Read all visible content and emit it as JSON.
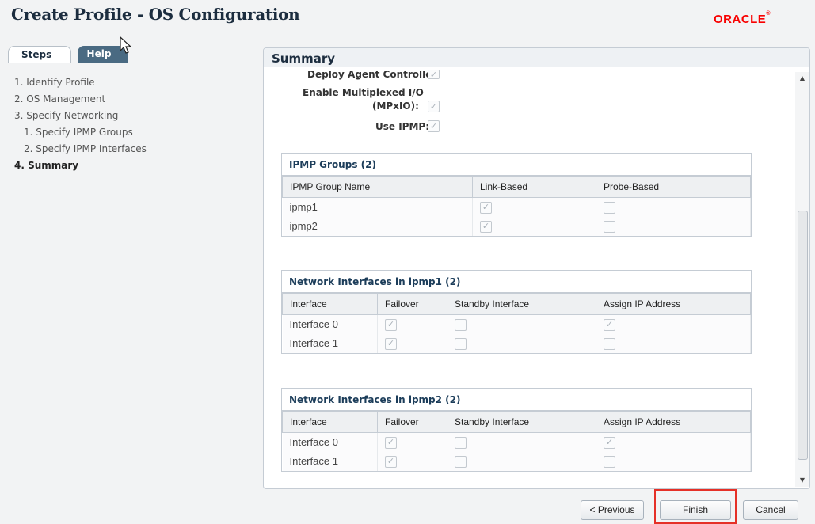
{
  "window": {
    "title": "Create Profile - OS Configuration",
    "brand": "ORACLE"
  },
  "tabs": {
    "steps": "Steps",
    "help": "Help"
  },
  "steps": [
    {
      "label": "1.  Identify Profile"
    },
    {
      "label": "2.  OS Management"
    },
    {
      "label": "3.  Specify Networking"
    },
    {
      "label": "1.  Specify IPMP Groups"
    },
    {
      "label": "2.  Specify IPMP Interfaces"
    },
    {
      "label": "4.  Summary"
    }
  ],
  "summary": {
    "title": "Summary",
    "fields": {
      "deploy_agent": {
        "label": "Deploy Agent Controller:",
        "checked": true
      },
      "mpxio_line1": "Enable Multiplexed I/O",
      "mpxio_line2": "(MPxIO):",
      "mpxio_checked": true,
      "use_ipmp": {
        "label": "Use IPMP:",
        "checked": true
      }
    },
    "ipmp_groups": {
      "title": "IPMP Groups (2)",
      "columns": [
        "IPMP Group Name",
        "Link-Based",
        "Probe-Based"
      ],
      "rows": [
        {
          "name": "ipmp1",
          "link_based": true,
          "probe_based": false
        },
        {
          "name": "ipmp2",
          "link_based": true,
          "probe_based": false
        }
      ]
    },
    "ipmp1_interfaces": {
      "title": "Network Interfaces in ipmp1 (2)",
      "columns": [
        "Interface",
        "Failover",
        "Standby Interface",
        "Assign IP Address"
      ],
      "rows": [
        {
          "name": "Interface 0",
          "failover": true,
          "standby": false,
          "assign_ip": true
        },
        {
          "name": "Interface 1",
          "failover": true,
          "standby": false,
          "assign_ip": false
        }
      ]
    },
    "ipmp2_interfaces": {
      "title": "Network Interfaces in ipmp2 (2)",
      "columns": [
        "Interface",
        "Failover",
        "Standby Interface",
        "Assign IP Address"
      ],
      "rows": [
        {
          "name": "Interface 0",
          "failover": true,
          "standby": false,
          "assign_ip": true
        },
        {
          "name": "Interface 1",
          "failover": true,
          "standby": false,
          "assign_ip": false
        }
      ]
    }
  },
  "buttons": {
    "previous": "< Previous",
    "finish": "Finish",
    "cancel": "Cancel"
  },
  "colors": {
    "brand": "#f80000",
    "highlight": "#e53027",
    "title": "#1c2d3f"
  }
}
